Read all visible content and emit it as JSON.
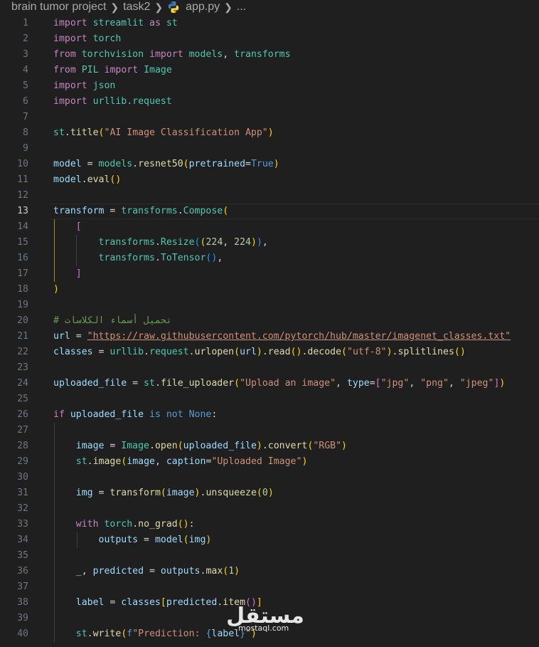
{
  "breadcrumb": {
    "items": [
      "brain tumor project",
      "task2",
      "app.py",
      "..."
    ]
  },
  "lines": [
    {
      "n": "1"
    },
    {
      "n": "2"
    },
    {
      "n": "3"
    },
    {
      "n": "4"
    },
    {
      "n": "5"
    },
    {
      "n": "6"
    },
    {
      "n": "7"
    },
    {
      "n": "8"
    },
    {
      "n": "9"
    },
    {
      "n": "10"
    },
    {
      "n": "11"
    },
    {
      "n": "12"
    },
    {
      "n": "13"
    },
    {
      "n": "14"
    },
    {
      "n": "15"
    },
    {
      "n": "16"
    },
    {
      "n": "17"
    },
    {
      "n": "18"
    },
    {
      "n": "19"
    },
    {
      "n": "20"
    },
    {
      "n": "21"
    },
    {
      "n": "22"
    },
    {
      "n": "23"
    },
    {
      "n": "24"
    },
    {
      "n": "25"
    },
    {
      "n": "26"
    },
    {
      "n": "27"
    },
    {
      "n": "28"
    },
    {
      "n": "29"
    },
    {
      "n": "30"
    },
    {
      "n": "31"
    },
    {
      "n": "32"
    },
    {
      "n": "33"
    },
    {
      "n": "34"
    },
    {
      "n": "35"
    },
    {
      "n": "36"
    },
    {
      "n": "37"
    },
    {
      "n": "38"
    },
    {
      "n": "39"
    },
    {
      "n": "40"
    }
  ],
  "code": [
    [
      [
        "k",
        "import"
      ],
      [
        "op",
        " "
      ],
      [
        "c",
        "streamlit"
      ],
      [
        "op",
        " "
      ],
      [
        "k",
        "as"
      ],
      [
        "op",
        " "
      ],
      [
        "c",
        "st"
      ]
    ],
    [
      [
        "k",
        "import"
      ],
      [
        "op",
        " "
      ],
      [
        "c",
        "torch"
      ]
    ],
    [
      [
        "k",
        "from"
      ],
      [
        "op",
        " "
      ],
      [
        "c",
        "torchvision"
      ],
      [
        "op",
        " "
      ],
      [
        "k",
        "import"
      ],
      [
        "op",
        " "
      ],
      [
        "c",
        "models"
      ],
      [
        "op",
        ", "
      ],
      [
        "c",
        "transforms"
      ]
    ],
    [
      [
        "k",
        "from"
      ],
      [
        "op",
        " "
      ],
      [
        "c",
        "PIL"
      ],
      [
        "op",
        " "
      ],
      [
        "k",
        "import"
      ],
      [
        "op",
        " "
      ],
      [
        "c",
        "Image"
      ]
    ],
    [
      [
        "k",
        "import"
      ],
      [
        "op",
        " "
      ],
      [
        "c",
        "json"
      ]
    ],
    [
      [
        "k",
        "import"
      ],
      [
        "op",
        " "
      ],
      [
        "c",
        "urllib.request"
      ]
    ],
    [],
    [
      [
        "c",
        "st"
      ],
      [
        "op",
        "."
      ],
      [
        "f",
        "title"
      ],
      [
        "p1",
        "("
      ],
      [
        "s",
        "\"AI Image Classification App\""
      ],
      [
        "p1",
        ")"
      ]
    ],
    [],
    [
      [
        "v",
        "model"
      ],
      [
        "op",
        " = "
      ],
      [
        "c",
        "models"
      ],
      [
        "op",
        "."
      ],
      [
        "f",
        "resnet50"
      ],
      [
        "p1",
        "("
      ],
      [
        "v",
        "pretrained"
      ],
      [
        "op",
        "="
      ],
      [
        "kb",
        "True"
      ],
      [
        "p1",
        ")"
      ]
    ],
    [
      [
        "v",
        "model"
      ],
      [
        "op",
        "."
      ],
      [
        "f",
        "eval"
      ],
      [
        "p1",
        "()"
      ]
    ],
    [],
    [
      [
        "v",
        "transform"
      ],
      [
        "op",
        " = "
      ],
      [
        "c",
        "transforms"
      ],
      [
        "op",
        "."
      ],
      [
        "c",
        "Compose"
      ],
      [
        "p1",
        "("
      ]
    ],
    [
      [
        "op",
        "    "
      ],
      [
        "p2",
        "["
      ]
    ],
    [
      [
        "op",
        "        "
      ],
      [
        "c",
        "transforms"
      ],
      [
        "op",
        "."
      ],
      [
        "c",
        "Resize"
      ],
      [
        "p3",
        "("
      ],
      [
        "p1",
        "("
      ],
      [
        "n",
        "224"
      ],
      [
        "op",
        ", "
      ],
      [
        "n",
        "224"
      ],
      [
        "p1",
        ")"
      ],
      [
        "p3",
        ")"
      ],
      [
        "op",
        ","
      ]
    ],
    [
      [
        "op",
        "        "
      ],
      [
        "c",
        "transforms"
      ],
      [
        "op",
        "."
      ],
      [
        "c",
        "ToTensor"
      ],
      [
        "p3",
        "()"
      ],
      [
        "op",
        ","
      ]
    ],
    [
      [
        "op",
        "    "
      ],
      [
        "p2",
        "]"
      ]
    ],
    [
      [
        "p1",
        ")"
      ]
    ],
    [],
    [
      [
        "cm",
        "# تحميل أسماء الكلاسات"
      ]
    ],
    [
      [
        "v",
        "url"
      ],
      [
        "op",
        " = "
      ],
      [
        "s",
        "\"https://raw.githubusercontent.com/pytorch/hub/master/imagenet_classes.txt\""
      ]
    ],
    [
      [
        "v",
        "classes"
      ],
      [
        "op",
        " = "
      ],
      [
        "c",
        "urllib"
      ],
      [
        "op",
        "."
      ],
      [
        "c",
        "request"
      ],
      [
        "op",
        "."
      ],
      [
        "f",
        "urlopen"
      ],
      [
        "p1",
        "("
      ],
      [
        "v",
        "url"
      ],
      [
        "p1",
        ")"
      ],
      [
        "op",
        "."
      ],
      [
        "f",
        "read"
      ],
      [
        "p1",
        "()"
      ],
      [
        "op",
        "."
      ],
      [
        "f",
        "decode"
      ],
      [
        "p1",
        "("
      ],
      [
        "s",
        "\"utf-8\""
      ],
      [
        "p1",
        ")"
      ],
      [
        "op",
        "."
      ],
      [
        "f",
        "splitlines"
      ],
      [
        "p1",
        "()"
      ]
    ],
    [],
    [
      [
        "v",
        "uploaded_file"
      ],
      [
        "op",
        " = "
      ],
      [
        "c",
        "st"
      ],
      [
        "op",
        "."
      ],
      [
        "f",
        "file_uploader"
      ],
      [
        "p1",
        "("
      ],
      [
        "s",
        "\"Upload an image\""
      ],
      [
        "op",
        ", "
      ],
      [
        "v",
        "type"
      ],
      [
        "op",
        "="
      ],
      [
        "p2",
        "["
      ],
      [
        "s",
        "\"jpg\""
      ],
      [
        "op",
        ", "
      ],
      [
        "s",
        "\"png\""
      ],
      [
        "op",
        ", "
      ],
      [
        "s",
        "\"jpeg\""
      ],
      [
        "p2",
        "]"
      ],
      [
        "p1",
        ")"
      ]
    ],
    [],
    [
      [
        "k",
        "if"
      ],
      [
        "op",
        " "
      ],
      [
        "v",
        "uploaded_file"
      ],
      [
        "op",
        " "
      ],
      [
        "kb",
        "is not"
      ],
      [
        "op",
        " "
      ],
      [
        "kb",
        "None"
      ],
      [
        "op",
        ":"
      ]
    ],
    [],
    [
      [
        "op",
        "    "
      ],
      [
        "v",
        "image"
      ],
      [
        "op",
        " = "
      ],
      [
        "c",
        "Image"
      ],
      [
        "op",
        "."
      ],
      [
        "f",
        "open"
      ],
      [
        "p1",
        "("
      ],
      [
        "v",
        "uploaded_file"
      ],
      [
        "p1",
        ")"
      ],
      [
        "op",
        "."
      ],
      [
        "f",
        "convert"
      ],
      [
        "p1",
        "("
      ],
      [
        "s",
        "\"RGB\""
      ],
      [
        "p1",
        ")"
      ]
    ],
    [
      [
        "op",
        "    "
      ],
      [
        "c",
        "st"
      ],
      [
        "op",
        "."
      ],
      [
        "f",
        "image"
      ],
      [
        "p1",
        "("
      ],
      [
        "v",
        "image"
      ],
      [
        "op",
        ", "
      ],
      [
        "v",
        "caption"
      ],
      [
        "op",
        "="
      ],
      [
        "s",
        "\"Uploaded Image\""
      ],
      [
        "p1",
        ")"
      ]
    ],
    [],
    [
      [
        "op",
        "    "
      ],
      [
        "v",
        "img"
      ],
      [
        "op",
        " = "
      ],
      [
        "f",
        "transform"
      ],
      [
        "p1",
        "("
      ],
      [
        "v",
        "image"
      ],
      [
        "p1",
        ")"
      ],
      [
        "op",
        "."
      ],
      [
        "f",
        "unsqueeze"
      ],
      [
        "p1",
        "("
      ],
      [
        "n",
        "0"
      ],
      [
        "p1",
        ")"
      ]
    ],
    [],
    [
      [
        "op",
        "    "
      ],
      [
        "k",
        "with"
      ],
      [
        "op",
        " "
      ],
      [
        "c",
        "torch"
      ],
      [
        "op",
        "."
      ],
      [
        "f",
        "no_grad"
      ],
      [
        "p1",
        "()"
      ],
      [
        "op",
        ":"
      ]
    ],
    [
      [
        "op",
        "        "
      ],
      [
        "v",
        "outputs"
      ],
      [
        "op",
        " = "
      ],
      [
        "v",
        "model"
      ],
      [
        "p1",
        "("
      ],
      [
        "v",
        "img"
      ],
      [
        "p1",
        ")"
      ]
    ],
    [],
    [
      [
        "op",
        "    "
      ],
      [
        "v",
        "_"
      ],
      [
        "op",
        ", "
      ],
      [
        "v",
        "predicted"
      ],
      [
        "op",
        " = "
      ],
      [
        "v",
        "outputs"
      ],
      [
        "op",
        "."
      ],
      [
        "f",
        "max"
      ],
      [
        "p1",
        "("
      ],
      [
        "n",
        "1"
      ],
      [
        "p1",
        ")"
      ]
    ],
    [],
    [
      [
        "op",
        "    "
      ],
      [
        "v",
        "label"
      ],
      [
        "op",
        " = "
      ],
      [
        "v",
        "classes"
      ],
      [
        "p1",
        "["
      ],
      [
        "v",
        "predicted"
      ],
      [
        "op",
        "."
      ],
      [
        "f",
        "item"
      ],
      [
        "p2",
        "()"
      ],
      [
        "p1",
        "]"
      ]
    ],
    [],
    [
      [
        "op",
        "    "
      ],
      [
        "c",
        "st"
      ],
      [
        "op",
        "."
      ],
      [
        "f",
        "write"
      ],
      [
        "p1",
        "("
      ],
      [
        "kb",
        "f"
      ],
      [
        "s",
        "\"Prediction: "
      ],
      [
        "kb",
        "{"
      ],
      [
        "v",
        "label"
      ],
      [
        "kb",
        "}"
      ],
      [
        "s",
        "\""
      ],
      [
        "p1",
        ")"
      ]
    ]
  ],
  "watermark": {
    "arabic": "مستقل",
    "latin": "mostaql.com"
  },
  "colors": {
    "background": "#1f1f1f",
    "keyword": "#c586c0",
    "string": "#ce9178",
    "class": "#4ec9b0",
    "function": "#dcdcaa"
  }
}
